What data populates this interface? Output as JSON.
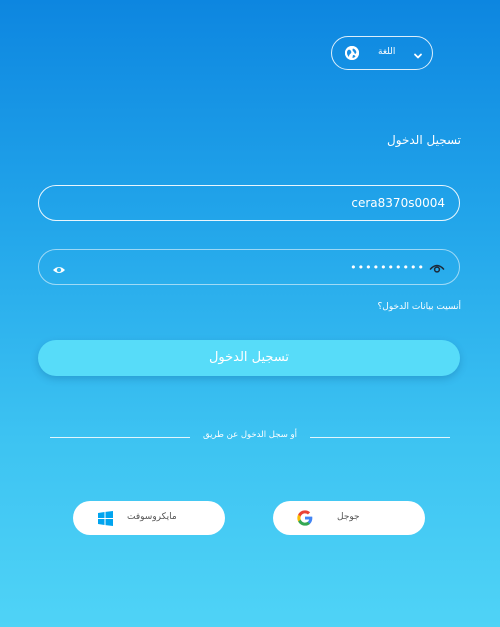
{
  "language_selector": {
    "label": "اللغة"
  },
  "login": {
    "title": "تسجيل الدخول",
    "username_value": "cera8370s0004",
    "password_value": "••••••••••",
    "forgot_link": "أنسيت بيانات الدخول؟",
    "submit_label": "تسجيل الدخول",
    "alt_login_text": "أو سجل الدخول عن طريق"
  },
  "social": {
    "microsoft_label": "مايكروسوفت",
    "google_label": "جوجل"
  },
  "icons": {
    "language": "globe-icon",
    "dropdown": "chevron-down-icon",
    "show_password": "eye-icon",
    "reveal_password": "eye-open-icon",
    "microsoft": "windows-logo-icon",
    "google": "google-logo-icon"
  },
  "colors": {
    "background_top": "#0d86e0",
    "background_bottom": "#4fd3f6",
    "login_button": "#57dcf9",
    "windows_blue": "#00a4ef"
  }
}
